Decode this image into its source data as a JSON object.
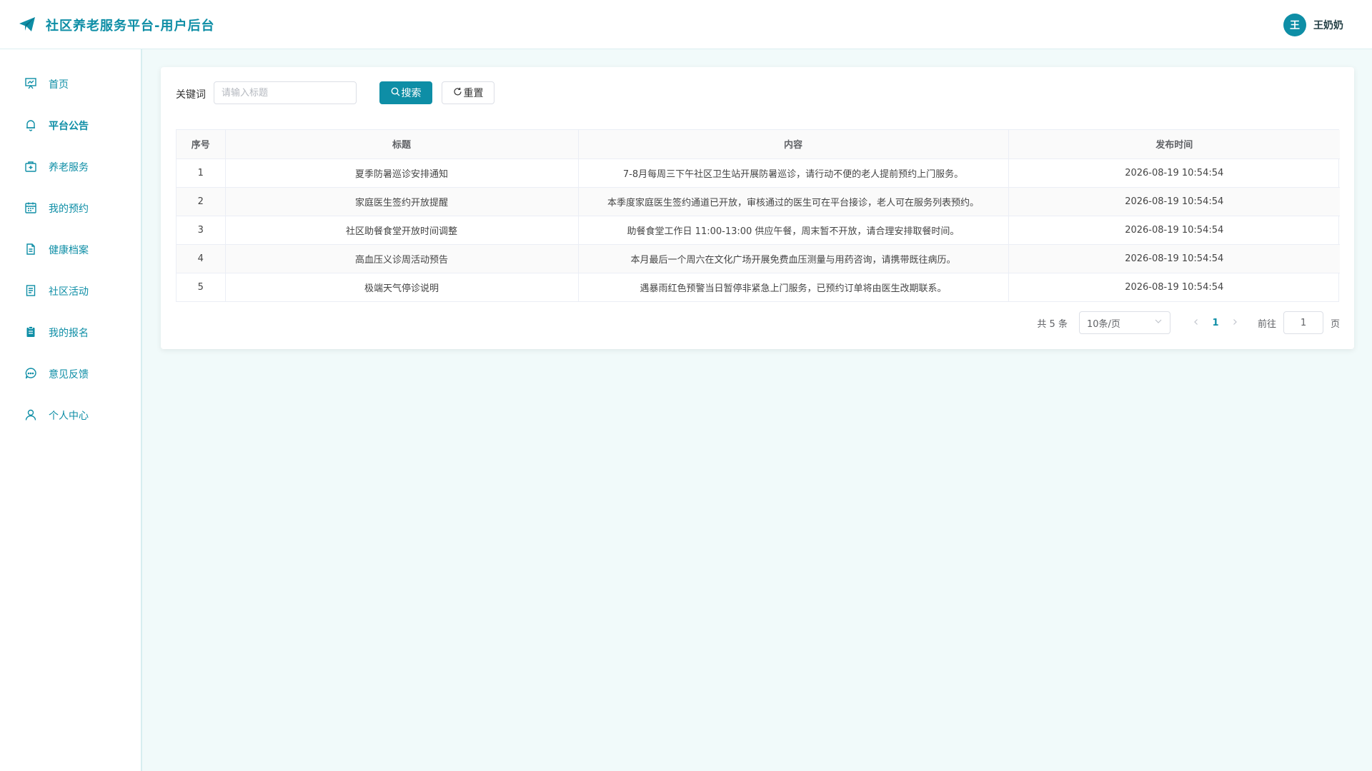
{
  "header": {
    "title": "社区养老服务平台-用户后台",
    "logo_icon": "paper-plane-icon",
    "user": {
      "avatar_letter": "王",
      "name": "王奶奶"
    }
  },
  "colors": {
    "accent": "#0e8ea6",
    "background": "#f1fafa"
  },
  "sidebar": {
    "items": [
      {
        "label": "首页",
        "icon": "chart-board-icon"
      },
      {
        "label": "平台公告",
        "icon": "bell-icon"
      },
      {
        "label": "养老服务",
        "icon": "medical-kit-icon"
      },
      {
        "label": "我的预约",
        "icon": "calendar-icon"
      },
      {
        "label": "健康档案",
        "icon": "document-icon"
      },
      {
        "label": "社区活动",
        "icon": "list-doc-icon"
      },
      {
        "label": "我的报名",
        "icon": "clipboard-icon"
      },
      {
        "label": "意见反馈",
        "icon": "chat-bubble-icon"
      },
      {
        "label": "个人中心",
        "icon": "user-icon"
      }
    ]
  },
  "search": {
    "label": "关键词",
    "placeholder": "请输入标题",
    "value": "",
    "search_button": "搜索",
    "reset_button": "重置"
  },
  "table": {
    "columns": [
      "序号",
      "标题",
      "内容",
      "发布时间"
    ],
    "rows": [
      [
        "1",
        "夏季防暑巡诊安排通知",
        "7-8月每周三下午社区卫生站开展防暑巡诊，请行动不便的老人提前预约上门服务。",
        "2026-08-19 10:54:54"
      ],
      [
        "2",
        "家庭医生签约开放提醒",
        "本季度家庭医生签约通道已开放，审核通过的医生可在平台接诊，老人可在服务列表预约。",
        "2026-08-19 10:54:54"
      ],
      [
        "3",
        "社区助餐食堂开放时间调整",
        "助餐食堂工作日 11:00-13:00 供应午餐，周末暂不开放，请合理安排取餐时间。",
        "2026-08-19 10:54:54"
      ],
      [
        "4",
        "高血压义诊周活动预告",
        "本月最后一个周六在文化广场开展免费血压测量与用药咨询，请携带既往病历。",
        "2026-08-19 10:54:54"
      ],
      [
        "5",
        "极端天气停诊说明",
        "遇暴雨红色预警当日暂停非紧急上门服务，已预约订单将由医生改期联系。",
        "2026-08-19 10:54:54"
      ]
    ]
  },
  "pagination": {
    "total": "共 5 条",
    "page_size": "10条/页",
    "current_page": "1",
    "goto_label": "前往",
    "goto_value": "1",
    "page_unit": "页"
  }
}
